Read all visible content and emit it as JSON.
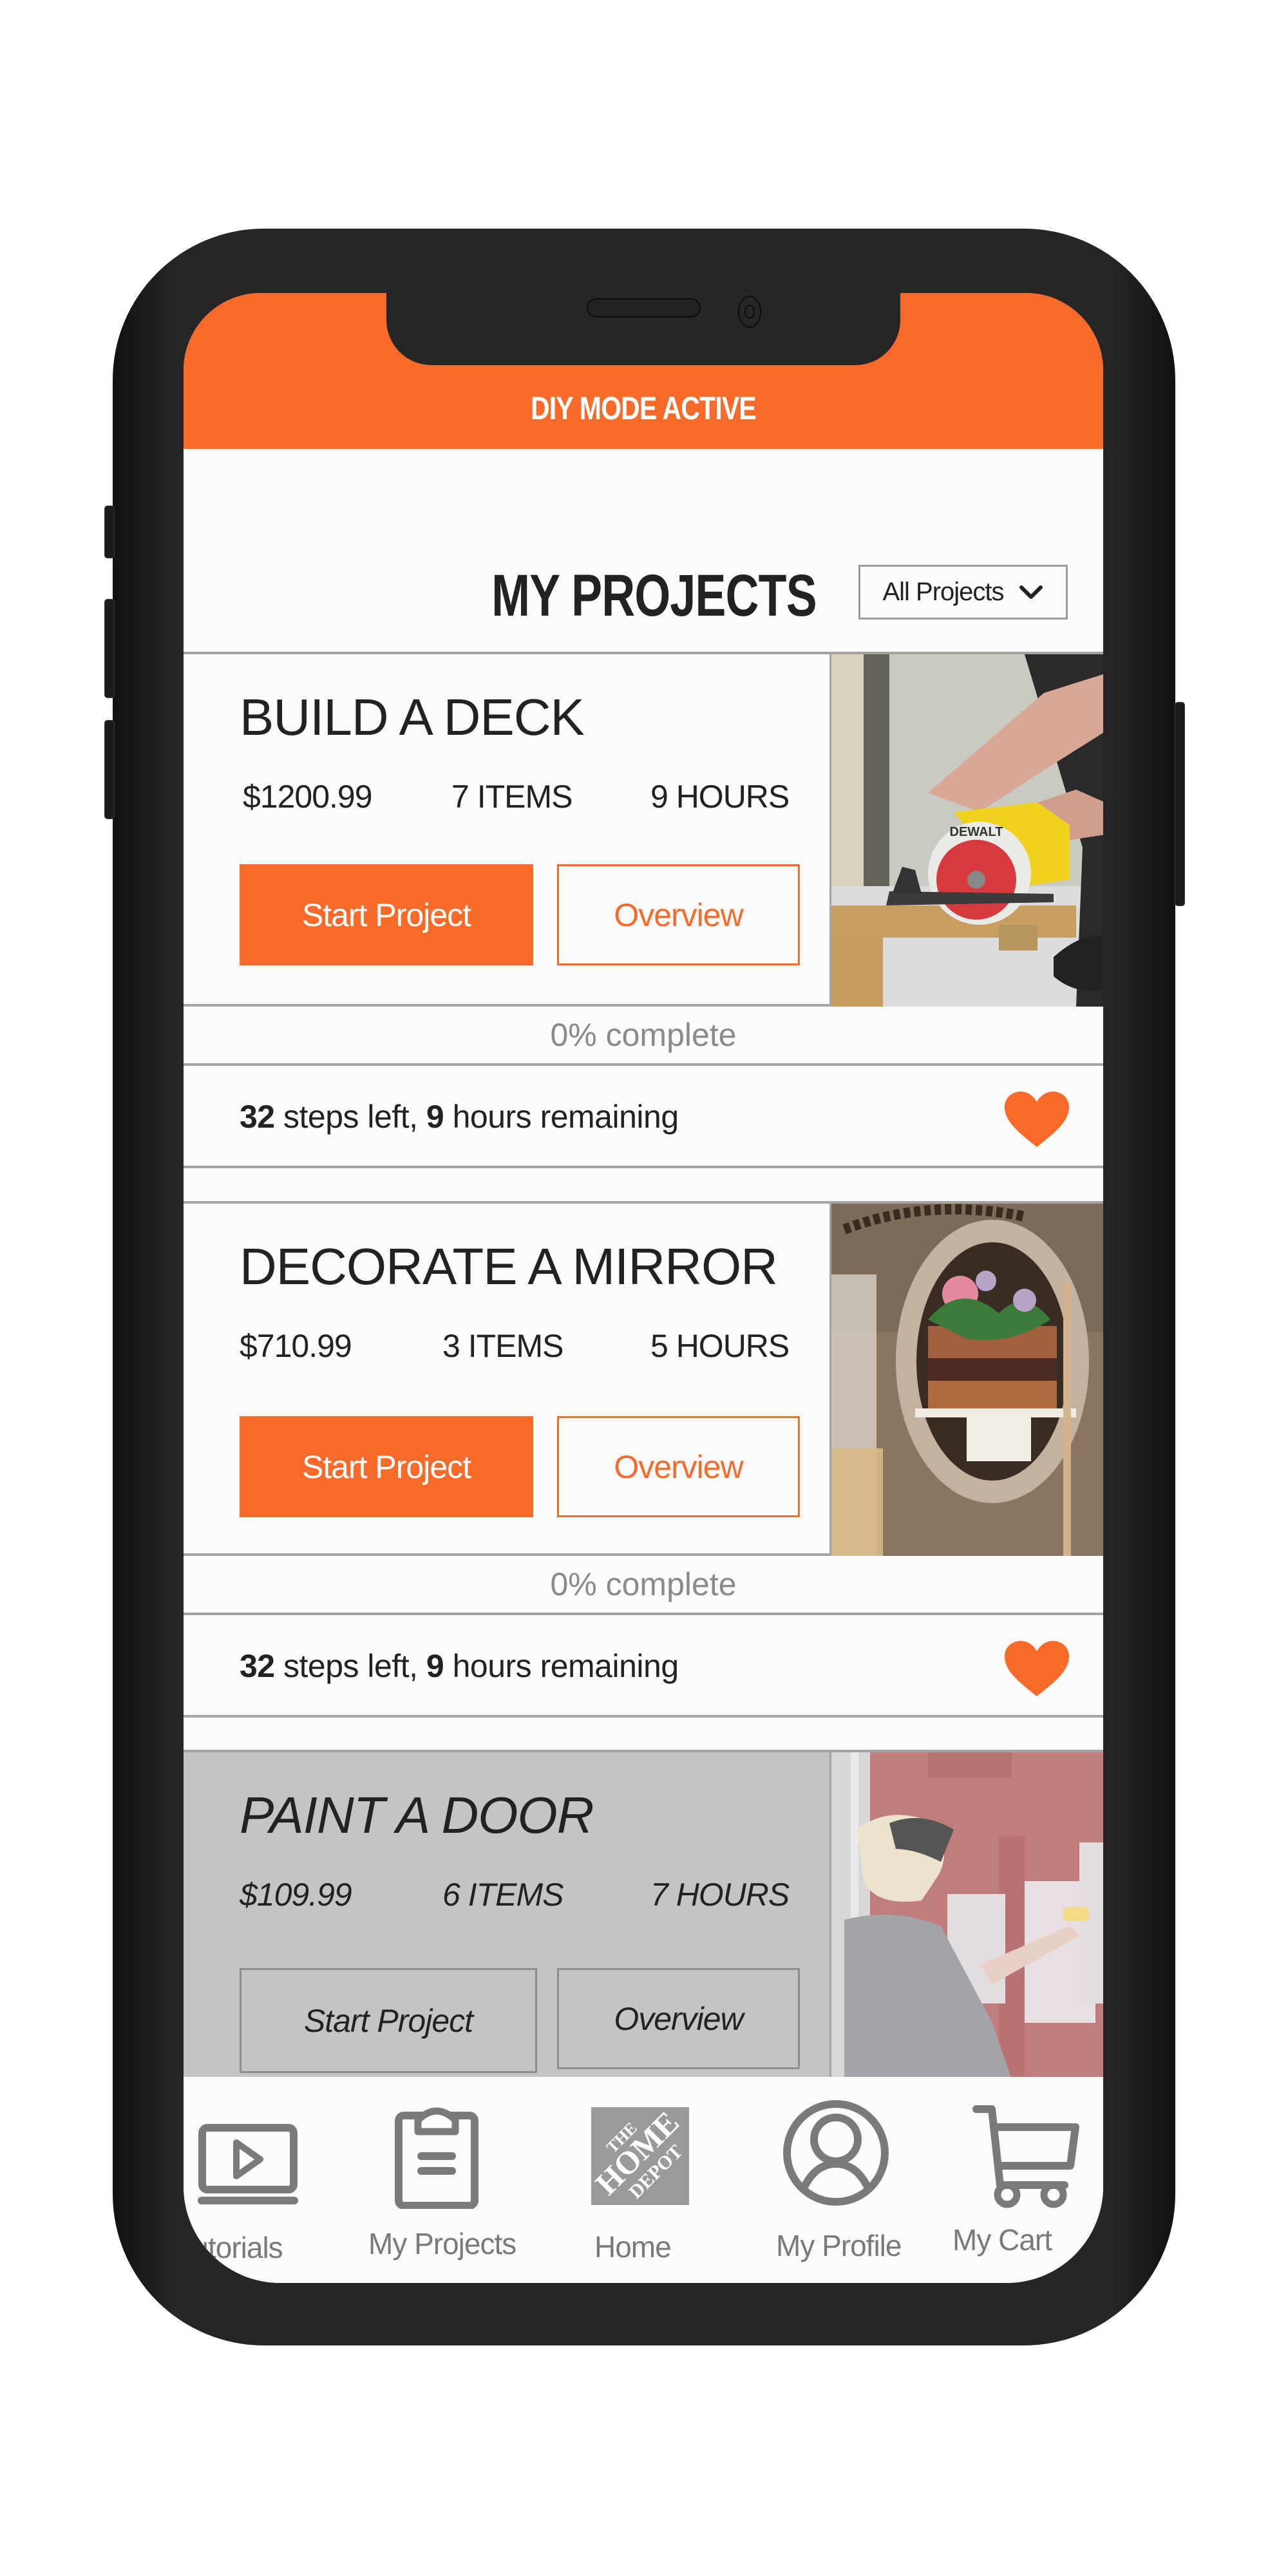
{
  "app": {
    "mode_banner": "DIY MODE ACTIVE",
    "accent_color": "#F76A2A"
  },
  "header": {
    "title": "MY PROJECTS",
    "filter": {
      "selected": "All Projects",
      "icon": "chevron-down-icon"
    }
  },
  "projects": [
    {
      "title": "BUILD A DECK",
      "price": "$1200.99",
      "items": "7 ITEMS",
      "hours": "9 HOURS",
      "start_label": "Start Project",
      "overview_label": "Overview",
      "image_alt": "Person cutting wood with a DeWalt circular saw",
      "progress_text": "0% complete",
      "progress_percent": 0,
      "steps_left": "32",
      "steps_mid": " steps left, ",
      "hours_left": "9",
      "steps_tail": " hours remaining",
      "favorite": true,
      "disabled": false
    },
    {
      "title": "DECORATE A MIRROR",
      "price": "$710.99",
      "items": "3 ITEMS",
      "hours": "5 HOURS",
      "start_label": "Start Project",
      "overview_label": "Overview",
      "image_alt": "Ornate vintage mirror reflecting a floral cake",
      "progress_text": "0% complete",
      "progress_percent": 0,
      "steps_left": "32",
      "steps_mid": " steps left, ",
      "hours_left": "9",
      "steps_tail": " hours remaining",
      "favorite": true,
      "disabled": false
    },
    {
      "title": "PAINT A DOOR",
      "price": "$109.99",
      "items": "6 ITEMS",
      "hours": "7 HOURS",
      "start_label": "Start Project",
      "overview_label": "Overview",
      "image_alt": "Woman painting a red door white with a roller",
      "disabled": true
    }
  ],
  "nav": {
    "items": [
      {
        "label": "Tutorials",
        "icon": "video-tutorial-icon"
      },
      {
        "label": "My Projects",
        "icon": "clipboard-icon"
      },
      {
        "label": "Home",
        "icon": "home-depot-logo-icon"
      },
      {
        "label": "My Profile",
        "icon": "profile-icon"
      },
      {
        "label": "My Cart",
        "icon": "cart-icon"
      }
    ]
  },
  "logo": {
    "line1": "THE",
    "line2": "HOME",
    "line3": "DEPOT"
  }
}
